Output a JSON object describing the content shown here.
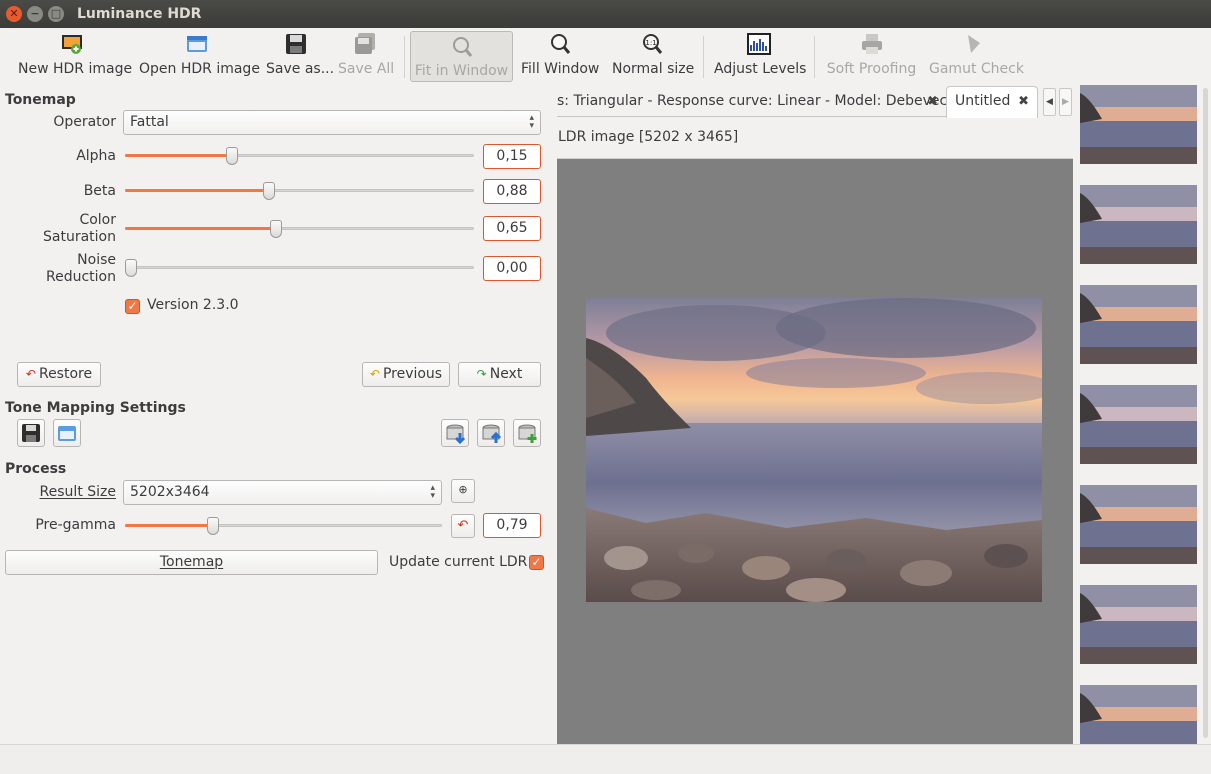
{
  "window": {
    "title": "Luminance HDR",
    "controls": [
      "close",
      "minimize",
      "maximize"
    ]
  },
  "toolbar": {
    "new_hdr": "New HDR image",
    "open_hdr": "Open HDR image",
    "save_as": "Save as...",
    "save_all": "Save All",
    "fit_in_window": "Fit in Window",
    "fill_window": "Fill Window",
    "normal_size": "Normal size",
    "normal_size_icon_text": "1:1",
    "adjust_levels": "Adjust Levels",
    "soft_proofing": "Soft Proofing",
    "gamut_check": "Gamut Check"
  },
  "tonemap": {
    "heading": "Tonemap",
    "operator_label": "Operator",
    "operator_value": "Fattal",
    "params": [
      {
        "label": "Alpha",
        "value": "0,15",
        "level": 0.3
      },
      {
        "label": "Beta",
        "value": "0,88",
        "level": 0.41
      },
      {
        "label": "Color Saturation",
        "value": "0,65",
        "level": 0.43
      },
      {
        "label": "Noise Reduction",
        "value": "0,00",
        "level": 0.0
      }
    ],
    "version_checkbox": {
      "label": "Version 2.3.0",
      "checked": true
    },
    "restore": "Restore",
    "previous": "Previous",
    "next": "Next"
  },
  "tone_mapping_settings": {
    "heading": "Tone Mapping Settings"
  },
  "process": {
    "heading": "Process",
    "result_size_label": "Result Size",
    "result_size_value": "5202x3464",
    "pregamma_label": "Pre-gamma",
    "pregamma_value": "0,79",
    "pregamma_level": 0.27,
    "tonemap_button": "Tonemap",
    "update_ldr_label": "Update current LDR",
    "update_ldr_checked": true
  },
  "tabs": [
    {
      "label": "s: Triangular - Response curve: Linear - Model: Debevec",
      "active": false
    },
    {
      "label": "Untitled",
      "active": true
    }
  ],
  "viewer": {
    "ldr_label": "LDR image [5202 x 3465]",
    "background": "#7f7f7f"
  },
  "thumbnails_count": 7,
  "colors": {
    "accent": "#f07746",
    "titlebar": "#3b3b37",
    "window_bg": "#f2f1f0"
  }
}
